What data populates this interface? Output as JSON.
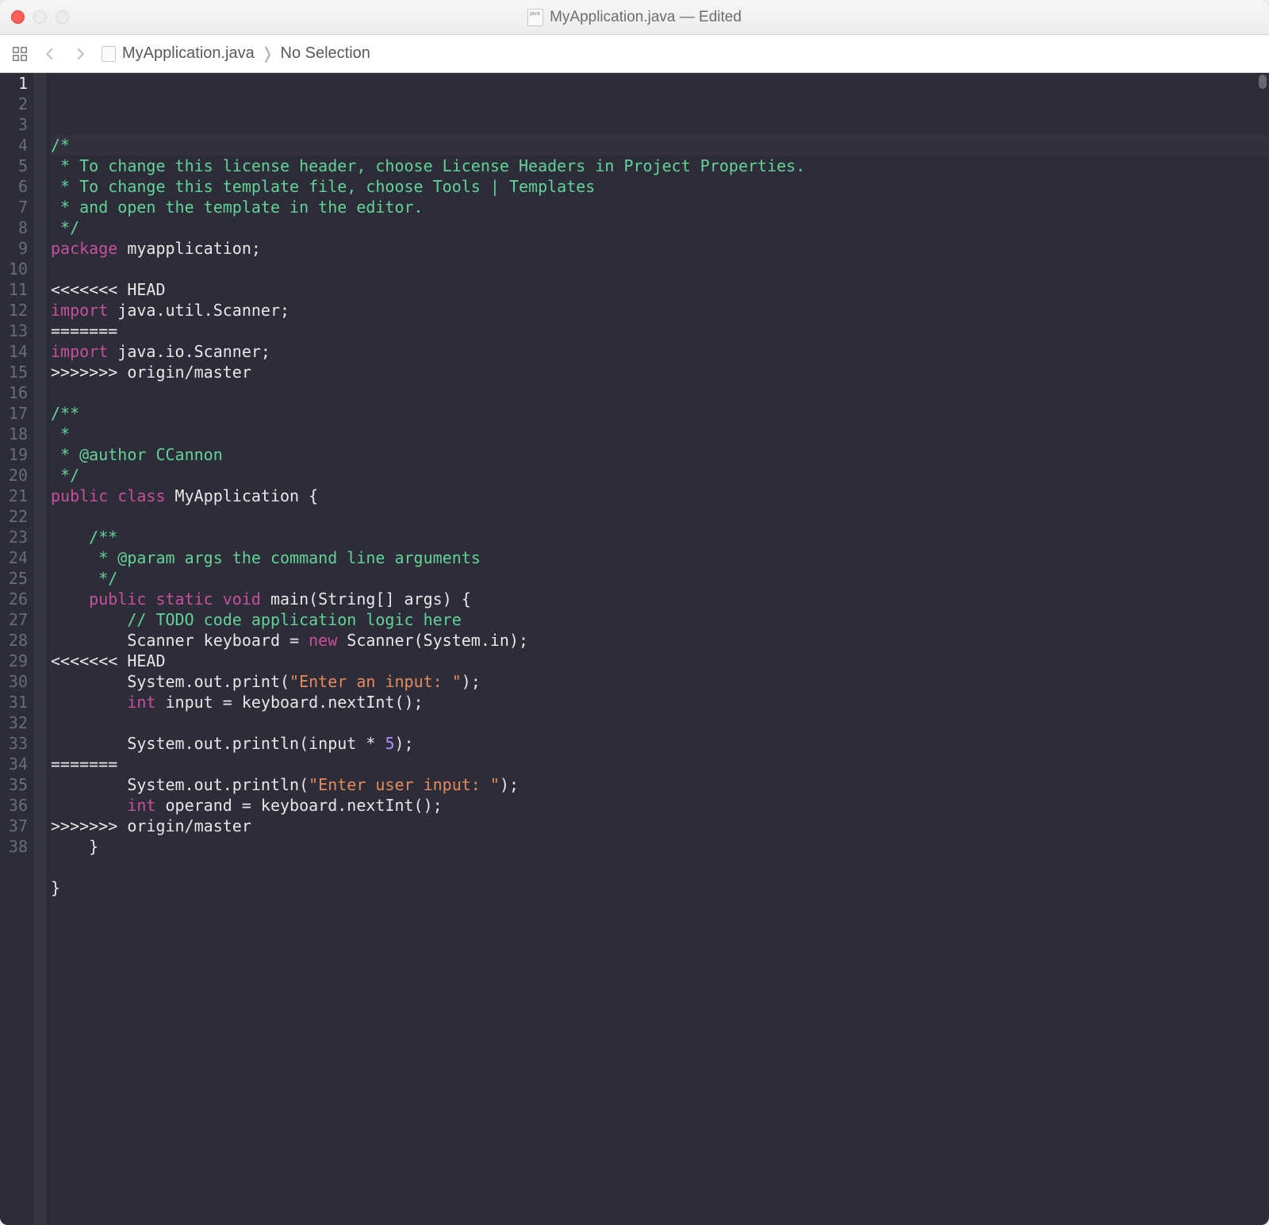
{
  "window": {
    "title": "MyApplication.java — Edited"
  },
  "breadcrumb": {
    "file": "MyApplication.java",
    "selection": "No Selection"
  },
  "gutter": {
    "current_line": 1,
    "total_lines": 38
  },
  "code": {
    "lines": [
      {
        "n": 1,
        "hl": true,
        "tokens": [
          [
            "comment",
            "/*"
          ]
        ]
      },
      {
        "n": 2,
        "hl": false,
        "tokens": [
          [
            "comment",
            " * To change this license header, choose License Headers in Project Properties."
          ]
        ]
      },
      {
        "n": 3,
        "hl": false,
        "tokens": [
          [
            "comment",
            " * To change this template file, choose Tools | Templates"
          ]
        ]
      },
      {
        "n": 4,
        "hl": false,
        "tokens": [
          [
            "comment",
            " * and open the template in the editor."
          ]
        ]
      },
      {
        "n": 5,
        "hl": false,
        "tokens": [
          [
            "comment",
            " */"
          ]
        ]
      },
      {
        "n": 6,
        "hl": false,
        "tokens": [
          [
            "keyword",
            "package"
          ],
          [
            "plain",
            " myapplication;"
          ]
        ]
      },
      {
        "n": 7,
        "hl": false,
        "tokens": []
      },
      {
        "n": 8,
        "hl": false,
        "tokens": [
          [
            "plain",
            "<<<<<<< HEAD"
          ]
        ]
      },
      {
        "n": 9,
        "hl": false,
        "tokens": [
          [
            "keyword",
            "import"
          ],
          [
            "plain",
            " java.util.Scanner;"
          ]
        ]
      },
      {
        "n": 10,
        "hl": false,
        "tokens": [
          [
            "plain",
            "======="
          ]
        ]
      },
      {
        "n": 11,
        "hl": false,
        "tokens": [
          [
            "keyword",
            "import"
          ],
          [
            "plain",
            " java.io.Scanner;"
          ]
        ]
      },
      {
        "n": 12,
        "hl": false,
        "tokens": [
          [
            "plain",
            ">>>>>>> origin/master"
          ]
        ]
      },
      {
        "n": 13,
        "hl": false,
        "tokens": []
      },
      {
        "n": 14,
        "hl": false,
        "tokens": [
          [
            "doccomment",
            "/**"
          ]
        ]
      },
      {
        "n": 15,
        "hl": false,
        "tokens": [
          [
            "doccomment",
            " *"
          ]
        ]
      },
      {
        "n": 16,
        "hl": false,
        "tokens": [
          [
            "doccomment",
            " * @author CCannon"
          ]
        ]
      },
      {
        "n": 17,
        "hl": false,
        "tokens": [
          [
            "doccomment",
            " */"
          ]
        ]
      },
      {
        "n": 18,
        "hl": false,
        "tokens": [
          [
            "keyword",
            "public"
          ],
          [
            "plain",
            " "
          ],
          [
            "keyword",
            "class"
          ],
          [
            "plain",
            " MyApplication {"
          ]
        ]
      },
      {
        "n": 19,
        "hl": false,
        "tokens": []
      },
      {
        "n": 20,
        "hl": false,
        "tokens": [
          [
            "doccomment",
            "    /**"
          ]
        ]
      },
      {
        "n": 21,
        "hl": false,
        "tokens": [
          [
            "doccomment",
            "     * @param args the command line arguments"
          ]
        ]
      },
      {
        "n": 22,
        "hl": false,
        "tokens": [
          [
            "doccomment",
            "     */"
          ]
        ]
      },
      {
        "n": 23,
        "hl": false,
        "tokens": [
          [
            "plain",
            "    "
          ],
          [
            "keyword",
            "public"
          ],
          [
            "plain",
            " "
          ],
          [
            "keyword",
            "static"
          ],
          [
            "plain",
            " "
          ],
          [
            "keyword",
            "void"
          ],
          [
            "plain",
            " main(String[] args) {"
          ]
        ]
      },
      {
        "n": 24,
        "hl": false,
        "tokens": [
          [
            "comment",
            "        // TODO code application logic here"
          ]
        ]
      },
      {
        "n": 25,
        "hl": false,
        "tokens": [
          [
            "plain",
            "        Scanner keyboard = "
          ],
          [
            "keyword",
            "new"
          ],
          [
            "plain",
            " Scanner(System.in);"
          ]
        ]
      },
      {
        "n": 26,
        "hl": false,
        "tokens": [
          [
            "plain",
            "<<<<<<< HEAD"
          ]
        ]
      },
      {
        "n": 27,
        "hl": false,
        "tokens": [
          [
            "plain",
            "        System.out.print("
          ],
          [
            "string",
            "\"Enter an input: \""
          ],
          [
            "plain",
            ");"
          ]
        ]
      },
      {
        "n": 28,
        "hl": false,
        "tokens": [
          [
            "plain",
            "        "
          ],
          [
            "keyword",
            "int"
          ],
          [
            "plain",
            " input = keyboard.nextInt();"
          ]
        ]
      },
      {
        "n": 29,
        "hl": false,
        "tokens": [
          [
            "plain",
            "        "
          ]
        ]
      },
      {
        "n": 30,
        "hl": false,
        "tokens": [
          [
            "plain",
            "        System.out.println(input * "
          ],
          [
            "number",
            "5"
          ],
          [
            "plain",
            ");"
          ]
        ]
      },
      {
        "n": 31,
        "hl": false,
        "tokens": [
          [
            "plain",
            "======="
          ]
        ]
      },
      {
        "n": 32,
        "hl": false,
        "tokens": [
          [
            "plain",
            "        System.out.println("
          ],
          [
            "string",
            "\"Enter user input: \""
          ],
          [
            "plain",
            ");"
          ]
        ]
      },
      {
        "n": 33,
        "hl": false,
        "tokens": [
          [
            "plain",
            "        "
          ],
          [
            "keyword",
            "int"
          ],
          [
            "plain",
            " operand = keyboard.nextInt();"
          ]
        ]
      },
      {
        "n": 34,
        "hl": false,
        "tokens": [
          [
            "plain",
            ">>>>>>> origin/master"
          ]
        ]
      },
      {
        "n": 35,
        "hl": false,
        "tokens": [
          [
            "plain",
            "    }"
          ]
        ]
      },
      {
        "n": 36,
        "hl": false,
        "tokens": [
          [
            "plain",
            "    "
          ]
        ]
      },
      {
        "n": 37,
        "hl": false,
        "tokens": [
          [
            "plain",
            "}"
          ]
        ]
      },
      {
        "n": 38,
        "hl": false,
        "tokens": []
      }
    ]
  }
}
